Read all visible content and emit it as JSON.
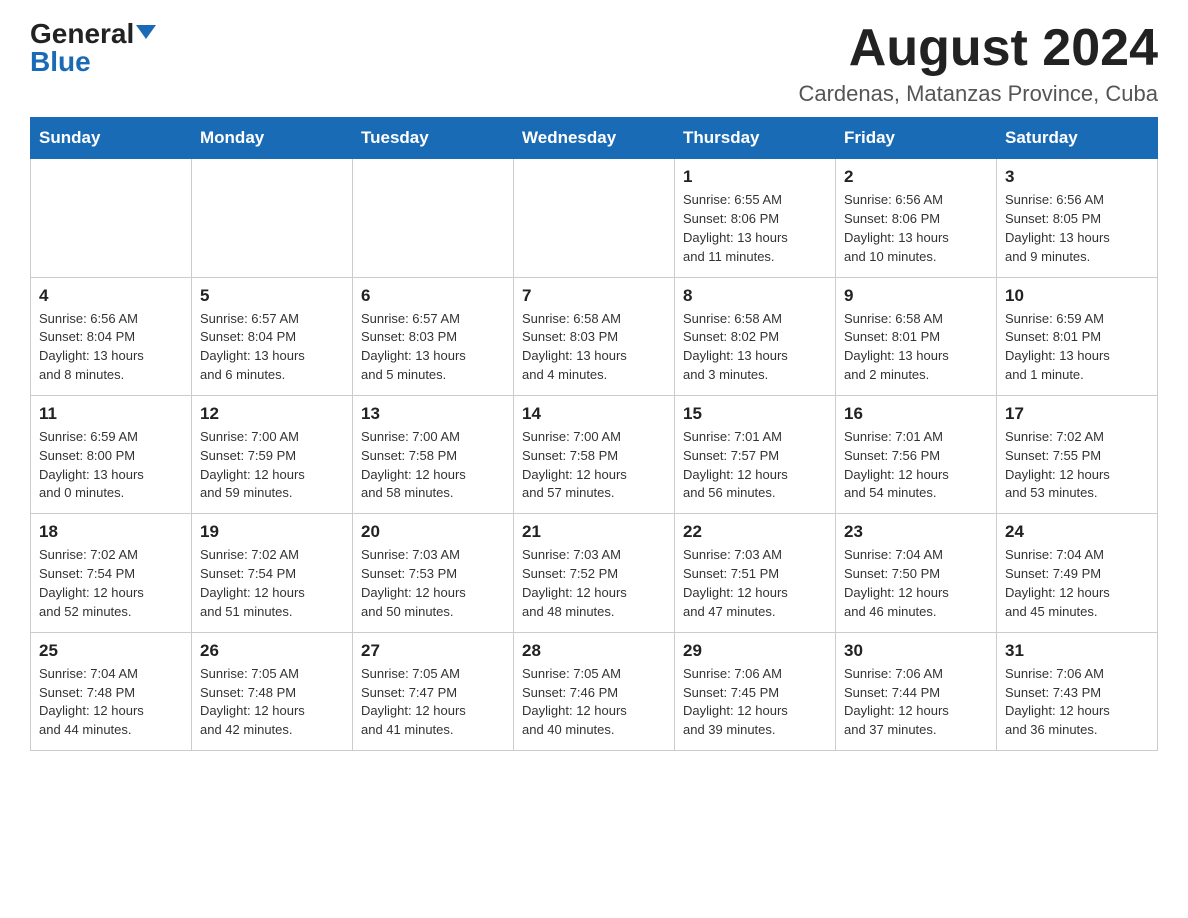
{
  "logo": {
    "general": "General",
    "blue": "Blue"
  },
  "header": {
    "title": "August 2024",
    "subtitle": "Cardenas, Matanzas Province, Cuba"
  },
  "weekdays": [
    "Sunday",
    "Monday",
    "Tuesday",
    "Wednesday",
    "Thursday",
    "Friday",
    "Saturday"
  ],
  "weeks": [
    [
      {
        "day": "",
        "info": ""
      },
      {
        "day": "",
        "info": ""
      },
      {
        "day": "",
        "info": ""
      },
      {
        "day": "",
        "info": ""
      },
      {
        "day": "1",
        "info": "Sunrise: 6:55 AM\nSunset: 8:06 PM\nDaylight: 13 hours\nand 11 minutes."
      },
      {
        "day": "2",
        "info": "Sunrise: 6:56 AM\nSunset: 8:06 PM\nDaylight: 13 hours\nand 10 minutes."
      },
      {
        "day": "3",
        "info": "Sunrise: 6:56 AM\nSunset: 8:05 PM\nDaylight: 13 hours\nand 9 minutes."
      }
    ],
    [
      {
        "day": "4",
        "info": "Sunrise: 6:56 AM\nSunset: 8:04 PM\nDaylight: 13 hours\nand 8 minutes."
      },
      {
        "day": "5",
        "info": "Sunrise: 6:57 AM\nSunset: 8:04 PM\nDaylight: 13 hours\nand 6 minutes."
      },
      {
        "day": "6",
        "info": "Sunrise: 6:57 AM\nSunset: 8:03 PM\nDaylight: 13 hours\nand 5 minutes."
      },
      {
        "day": "7",
        "info": "Sunrise: 6:58 AM\nSunset: 8:03 PM\nDaylight: 13 hours\nand 4 minutes."
      },
      {
        "day": "8",
        "info": "Sunrise: 6:58 AM\nSunset: 8:02 PM\nDaylight: 13 hours\nand 3 minutes."
      },
      {
        "day": "9",
        "info": "Sunrise: 6:58 AM\nSunset: 8:01 PM\nDaylight: 13 hours\nand 2 minutes."
      },
      {
        "day": "10",
        "info": "Sunrise: 6:59 AM\nSunset: 8:01 PM\nDaylight: 13 hours\nand 1 minute."
      }
    ],
    [
      {
        "day": "11",
        "info": "Sunrise: 6:59 AM\nSunset: 8:00 PM\nDaylight: 13 hours\nand 0 minutes."
      },
      {
        "day": "12",
        "info": "Sunrise: 7:00 AM\nSunset: 7:59 PM\nDaylight: 12 hours\nand 59 minutes."
      },
      {
        "day": "13",
        "info": "Sunrise: 7:00 AM\nSunset: 7:58 PM\nDaylight: 12 hours\nand 58 minutes."
      },
      {
        "day": "14",
        "info": "Sunrise: 7:00 AM\nSunset: 7:58 PM\nDaylight: 12 hours\nand 57 minutes."
      },
      {
        "day": "15",
        "info": "Sunrise: 7:01 AM\nSunset: 7:57 PM\nDaylight: 12 hours\nand 56 minutes."
      },
      {
        "day": "16",
        "info": "Sunrise: 7:01 AM\nSunset: 7:56 PM\nDaylight: 12 hours\nand 54 minutes."
      },
      {
        "day": "17",
        "info": "Sunrise: 7:02 AM\nSunset: 7:55 PM\nDaylight: 12 hours\nand 53 minutes."
      }
    ],
    [
      {
        "day": "18",
        "info": "Sunrise: 7:02 AM\nSunset: 7:54 PM\nDaylight: 12 hours\nand 52 minutes."
      },
      {
        "day": "19",
        "info": "Sunrise: 7:02 AM\nSunset: 7:54 PM\nDaylight: 12 hours\nand 51 minutes."
      },
      {
        "day": "20",
        "info": "Sunrise: 7:03 AM\nSunset: 7:53 PM\nDaylight: 12 hours\nand 50 minutes."
      },
      {
        "day": "21",
        "info": "Sunrise: 7:03 AM\nSunset: 7:52 PM\nDaylight: 12 hours\nand 48 minutes."
      },
      {
        "day": "22",
        "info": "Sunrise: 7:03 AM\nSunset: 7:51 PM\nDaylight: 12 hours\nand 47 minutes."
      },
      {
        "day": "23",
        "info": "Sunrise: 7:04 AM\nSunset: 7:50 PM\nDaylight: 12 hours\nand 46 minutes."
      },
      {
        "day": "24",
        "info": "Sunrise: 7:04 AM\nSunset: 7:49 PM\nDaylight: 12 hours\nand 45 minutes."
      }
    ],
    [
      {
        "day": "25",
        "info": "Sunrise: 7:04 AM\nSunset: 7:48 PM\nDaylight: 12 hours\nand 44 minutes."
      },
      {
        "day": "26",
        "info": "Sunrise: 7:05 AM\nSunset: 7:48 PM\nDaylight: 12 hours\nand 42 minutes."
      },
      {
        "day": "27",
        "info": "Sunrise: 7:05 AM\nSunset: 7:47 PM\nDaylight: 12 hours\nand 41 minutes."
      },
      {
        "day": "28",
        "info": "Sunrise: 7:05 AM\nSunset: 7:46 PM\nDaylight: 12 hours\nand 40 minutes."
      },
      {
        "day": "29",
        "info": "Sunrise: 7:06 AM\nSunset: 7:45 PM\nDaylight: 12 hours\nand 39 minutes."
      },
      {
        "day": "30",
        "info": "Sunrise: 7:06 AM\nSunset: 7:44 PM\nDaylight: 12 hours\nand 37 minutes."
      },
      {
        "day": "31",
        "info": "Sunrise: 7:06 AM\nSunset: 7:43 PM\nDaylight: 12 hours\nand 36 minutes."
      }
    ]
  ]
}
